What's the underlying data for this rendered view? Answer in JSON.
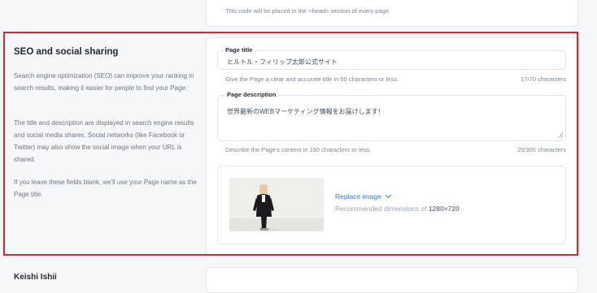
{
  "top": {
    "head_help": "This code will be placed in the <head> section of every page."
  },
  "seo": {
    "title": "SEO and social sharing",
    "para1": "Search engine optimization (SEO) can improve your ranking in search results, making it easier for people to find your Page.",
    "para2": "The title and description are displayed in search engine results and social media shares. Social networks (like Facebook or Twitter) may also show the social image when your URL is shared.",
    "para3": "If you leave these fields blank, we'll use your Page name as the Page title."
  },
  "form": {
    "page_title_label": "Page title",
    "page_title_value": "ヒルトル・フィリップ太郎公式サイト",
    "page_title_help": "Give the Page a clear and accurate title in 60 characters or less.",
    "page_title_count": "17/70 characters",
    "page_desc_label": "Page description",
    "page_desc_value": "世界最新のWEBマーケティング情報をお届けします！",
    "page_desc_help": "Describe the Page's content in 160 characters or less.",
    "page_desc_count": "25/300 characters",
    "replace_image": "Replace image",
    "rec_prefix": "Recommended dimensions of ",
    "rec_dims": "1280×720"
  },
  "next_section": {
    "title": "Keishi Ishii"
  },
  "colors": {
    "accent": "#3a78c9",
    "highlight_border": "#d9262e"
  }
}
